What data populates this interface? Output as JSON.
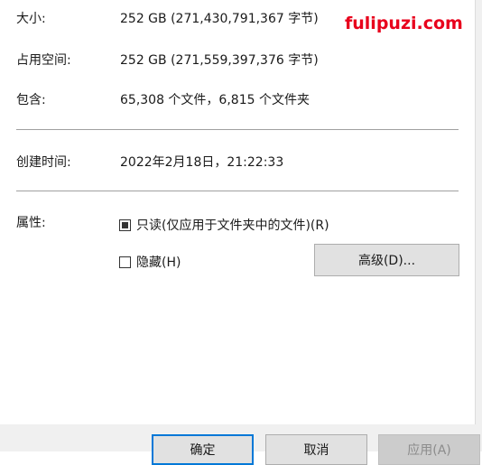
{
  "watermark": "fulipuzi.com",
  "general": {
    "size": {
      "label": "大小:",
      "value": "252 GB (271,430,791,367 字节)"
    },
    "size_on_disk": {
      "label": "占用空间:",
      "value": "252 GB (271,559,397,376 字节)"
    },
    "contains": {
      "label": "包含:",
      "value": "65,308 个文件，6,815 个文件夹"
    },
    "created": {
      "label": "创建时间:",
      "value": "2022年2月18日，21:22:33"
    }
  },
  "attributes": {
    "label": "属性:",
    "readonly": {
      "label": "只读(仅应用于文件夹中的文件)(R)",
      "state": "indeterminate"
    },
    "hidden": {
      "label": "隐藏(H)",
      "state": "unchecked"
    },
    "advanced_button": "高级(D)..."
  },
  "footer": {
    "ok": "确定",
    "cancel": "取消",
    "apply": "应用(A)"
  }
}
